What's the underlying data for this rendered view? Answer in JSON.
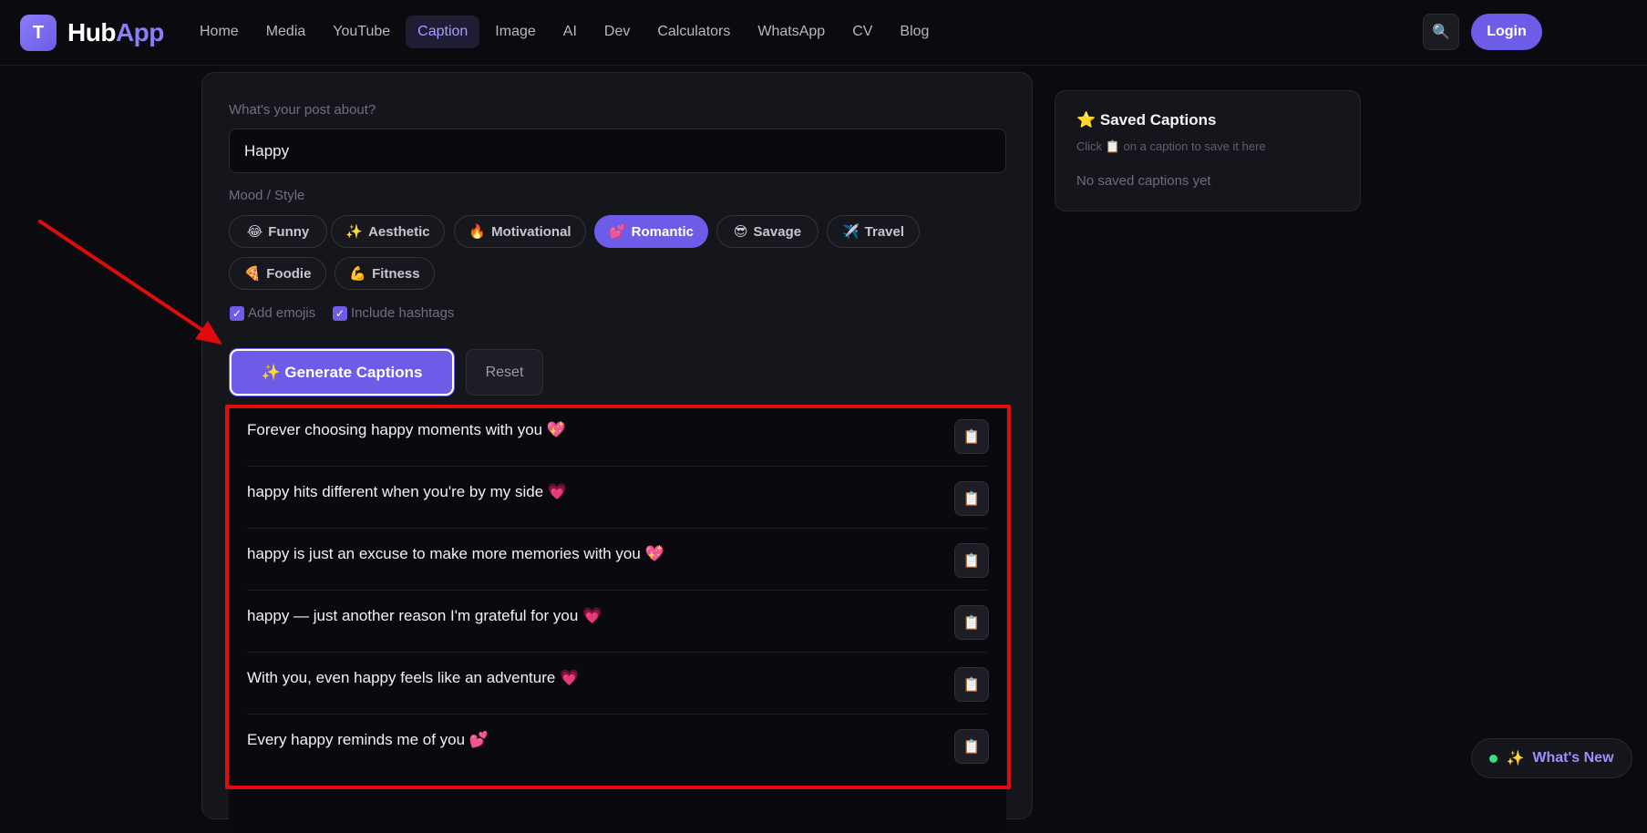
{
  "header": {
    "logo_letter": "T",
    "logo_hub": "Hub",
    "logo_app": "App",
    "nav": [
      "Home",
      "Media",
      "YouTube",
      "Caption",
      "Image",
      "AI",
      "Dev",
      "Calculators",
      "WhatsApp",
      "CV",
      "Blog"
    ],
    "active_nav": "Caption",
    "search_icon": "🔍",
    "login_label": "Login"
  },
  "form": {
    "topic_label": "What's your post about?",
    "topic_value": "Happy",
    "mood_label": "Mood / Style",
    "moods": [
      {
        "emoji": "😂",
        "label": "Funny"
      },
      {
        "emoji": "✨",
        "label": "Aesthetic"
      },
      {
        "emoji": "🔥",
        "label": "Motivational"
      },
      {
        "emoji": "💕",
        "label": "Romantic"
      },
      {
        "emoji": "😎",
        "label": "Savage"
      },
      {
        "emoji": "✈️",
        "label": "Travel"
      },
      {
        "emoji": "🍕",
        "label": "Foodie"
      },
      {
        "emoji": "💪",
        "label": "Fitness"
      }
    ],
    "active_mood": "Romantic",
    "options": [
      {
        "label": "Add emojis",
        "checked": true
      },
      {
        "label": "Include hashtags",
        "checked": true
      }
    ],
    "generate_label": "✨ Generate Captions",
    "reset_label": "Reset"
  },
  "results": [
    {
      "text": "Forever choosing happy moments with you 💖",
      "copy_icon": "📋"
    },
    {
      "text": "happy hits different when you're by my side 💗",
      "copy_icon": "📋"
    },
    {
      "text": "happy is just an excuse to make more memories with you 💖",
      "copy_icon": "📋"
    },
    {
      "text": "happy — just another reason I'm grateful for you 💗",
      "copy_icon": "📋"
    },
    {
      "text": "With you, even happy feels like an adventure 💗",
      "copy_icon": "📋"
    },
    {
      "text": "Every happy reminds me of you 💕",
      "copy_icon": "📋"
    }
  ],
  "saved": {
    "title": "⭐ Saved Captions",
    "hint": "Click 📋 on a caption to save it here",
    "empty": "No saved captions yet"
  },
  "whats_new": {
    "icon": "✨",
    "label": "What's New"
  },
  "colors": {
    "accent": "#6c5ce7",
    "annotation_red": "#e00b0b",
    "status_dot": "#3ddc84"
  }
}
